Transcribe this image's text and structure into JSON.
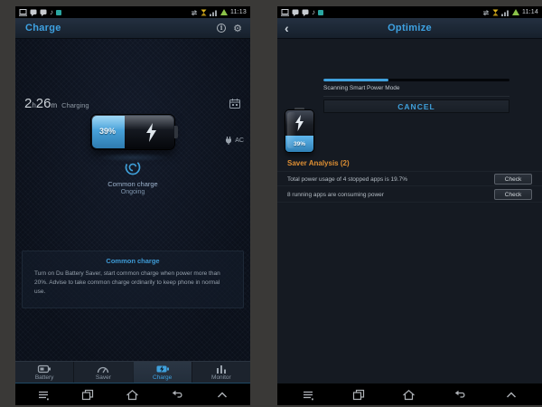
{
  "colors": {
    "accent_blue": "#3ea2e2",
    "battery_fill_blue": "#4aa7e6",
    "analysis_orange": "#de8f33",
    "charging_green": "#8bc34a",
    "collage_background": "#3a3937"
  },
  "left_screen": {
    "status_bar": {
      "time": "11:13"
    },
    "header": {
      "title": "Charge"
    },
    "charging": {
      "hours": "2",
      "hours_unit": "h",
      "minutes": "26",
      "minutes_unit": "m",
      "label": "Charging",
      "battery_percent": "39%",
      "power_source": "AC"
    },
    "state": {
      "line1": "Common charge",
      "line2": "Ongoing"
    },
    "info_box": {
      "title": "Common charge",
      "body": "Turn on Du Battery Saver, start common charge when power more than 20%. Advise to take common charge ordinarily to keep phone in normal use."
    },
    "tabs": [
      {
        "label": "Battery",
        "active": false
      },
      {
        "label": "Saver",
        "active": false
      },
      {
        "label": "Charge",
        "active": true
      },
      {
        "label": "Monitor",
        "active": false
      }
    ]
  },
  "right_screen": {
    "status_bar": {
      "time": "11:14"
    },
    "header": {
      "title": "Optimize",
      "back_icon": "‹"
    },
    "scan": {
      "progress_percent": 35,
      "status_text": "Scanning Smart Power Mode",
      "cancel_label": "CANCEL",
      "battery_percent": "39%"
    },
    "analysis": {
      "title": "Saver Analysis (2)",
      "items": [
        {
          "text": "Total power usage of 4 stopped apps is 19.7%",
          "action": "Check"
        },
        {
          "text": "8 running apps are consuming power",
          "action": "Check"
        }
      ]
    }
  }
}
